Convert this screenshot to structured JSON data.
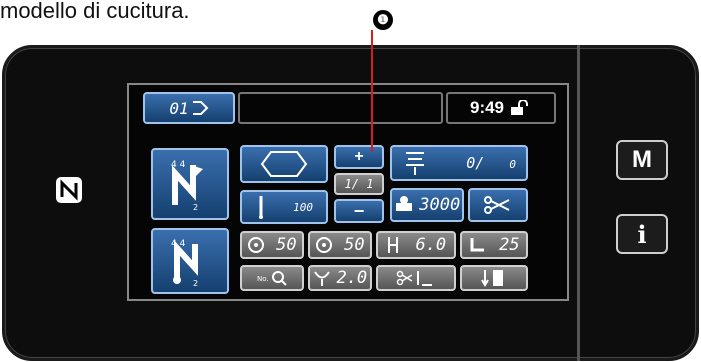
{
  "caption": "modello di cucitura.",
  "callout": {
    "number": "❶"
  },
  "header": {
    "pattern_no": "01",
    "time": "9:49"
  },
  "buttons": {
    "plus": "+",
    "minus": "−",
    "stitch_count": "1/ 1",
    "counter_value": "0/",
    "counter_value2": "0",
    "needle_value": "100",
    "speed_value": "3000",
    "tension_left": "50",
    "tension_right": "50",
    "pitch": "6.0",
    "length": "25",
    "thread": "2.0"
  },
  "side": {
    "m_label": "M",
    "i_label": "i"
  }
}
